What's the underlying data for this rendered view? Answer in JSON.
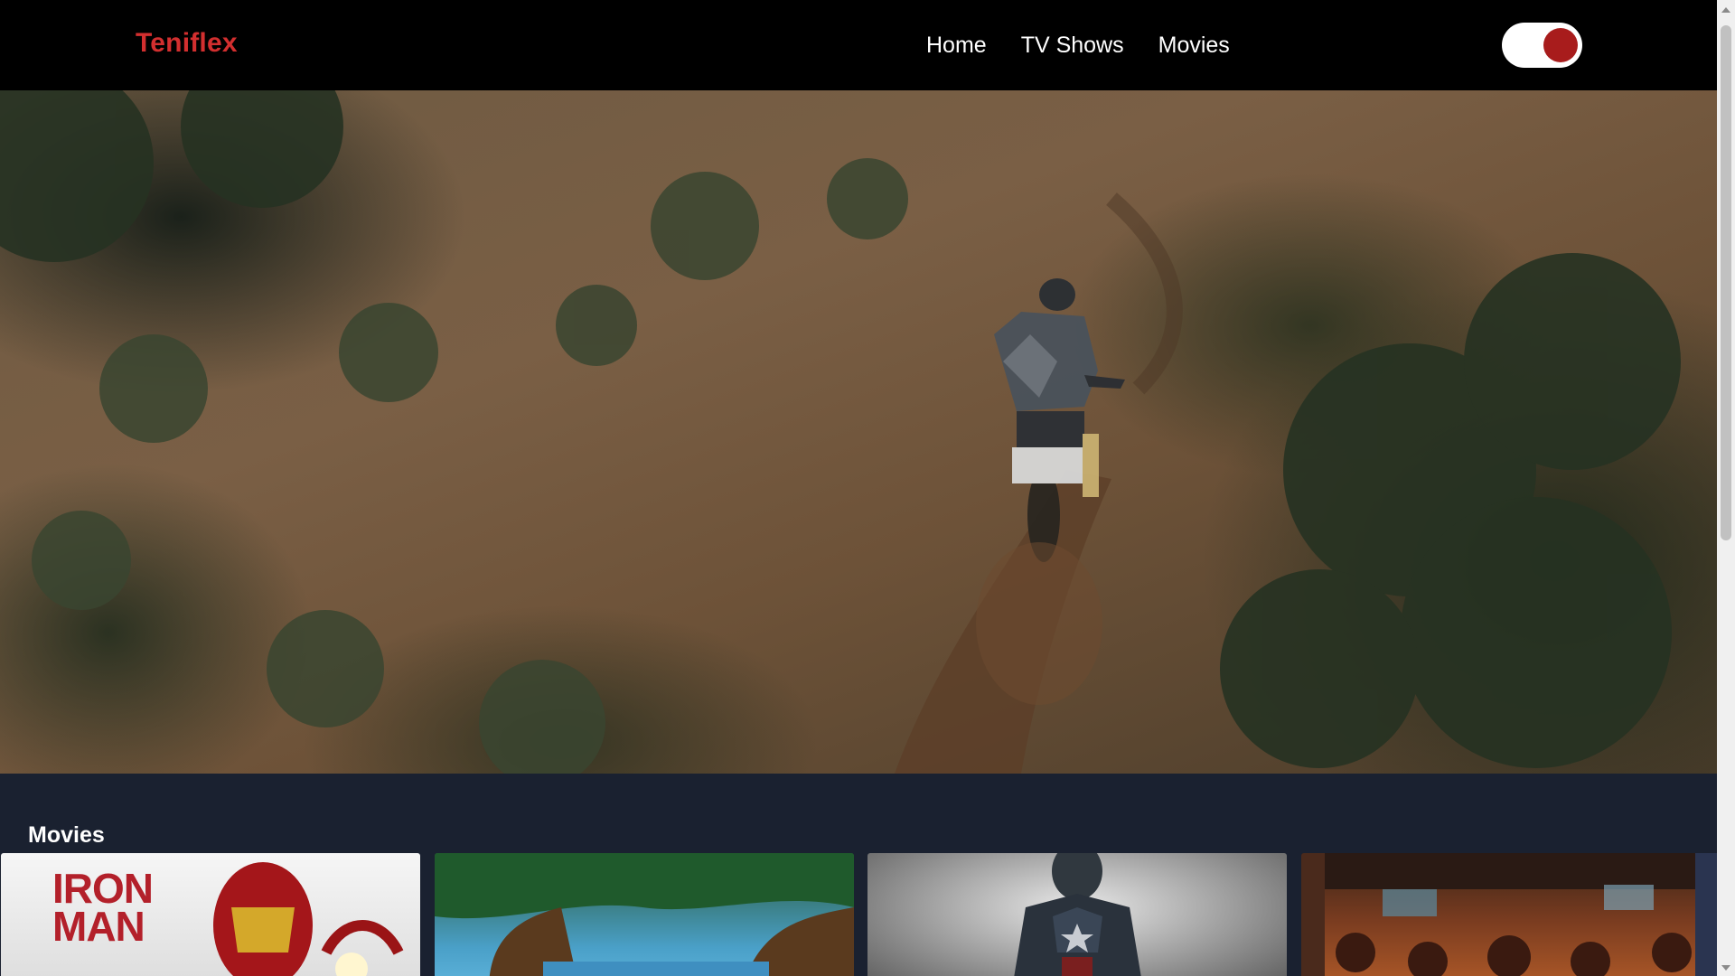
{
  "app": {
    "brand": "Teniflex"
  },
  "nav": {
    "items": [
      {
        "label": "Home"
      },
      {
        "label": "TV Shows"
      },
      {
        "label": "Movies"
      }
    ]
  },
  "theme_toggle": {
    "state": "on",
    "knob_color": "#a81c1c"
  },
  "hero": {
    "media": "motocross-rider-video"
  },
  "movies_section": {
    "title": "Movies",
    "cards": [
      {
        "poster": "iron-man-poster",
        "art_text": "IRON MAN"
      },
      {
        "poster": "forest-lake-poster"
      },
      {
        "poster": "captain-america-poster"
      },
      {
        "poster": "avengers-group-poster"
      }
    ]
  },
  "colors": {
    "brand": "#d32f2f",
    "nav_bg": "#000000",
    "page_bg": "#1a2130"
  }
}
